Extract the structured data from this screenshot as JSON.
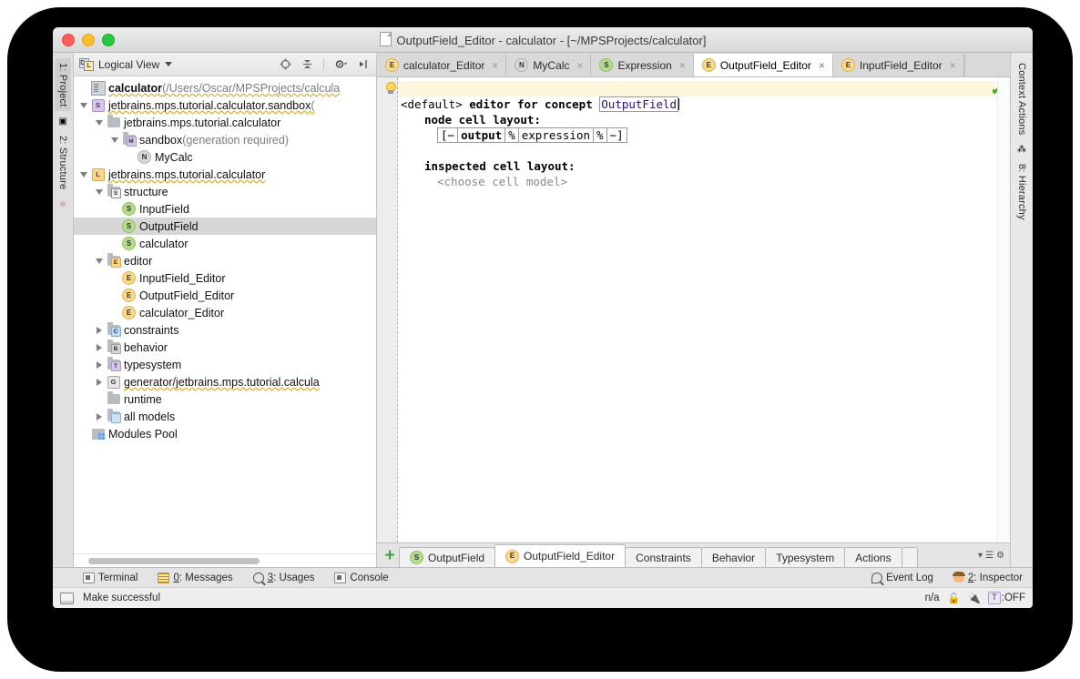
{
  "window": {
    "title": "OutputField_Editor - calculator - [~/MPSProjects/calculator]",
    "traffic": {
      "close": "close-button",
      "minimize": "minimize-button",
      "zoom": "zoom-button"
    }
  },
  "left_strip": {
    "tabs": [
      {
        "label": "1: Project",
        "active": true
      },
      {
        "label": "2: Structure",
        "active": false
      }
    ]
  },
  "right_strip": {
    "tabs": [
      {
        "label": "Context Actions"
      },
      {
        "label": "8: Hierarchy"
      }
    ]
  },
  "project_panel": {
    "view_label": "Logical View",
    "toolbar": {
      "locate": "locate-icon",
      "collapse": "collapse-all-icon",
      "settings": "gear-icon",
      "hide": "hide-panel-icon"
    },
    "tree": [
      {
        "indent": 0,
        "twist": "none",
        "icon": "project",
        "label": "calculator",
        "bold": true,
        "suffix": " (/Users/Oscar/MPSProjects/calcula",
        "squiggle": true
      },
      {
        "indent": 0,
        "twist": "down",
        "icon": "badge-s-purple",
        "label": "jetbrains.mps.tutorial.calculator.sandbox",
        "suffix": " (",
        "squiggle": true
      },
      {
        "indent": 1,
        "twist": "down",
        "icon": "folder",
        "label": "jetbrains.mps.tutorial.calculator"
      },
      {
        "indent": 2,
        "twist": "down",
        "icon": "folder-m",
        "label": "sandbox",
        "suffix": " (generation required)"
      },
      {
        "indent": 3,
        "twist": "none",
        "icon": "badge-n",
        "label": "MyCalc"
      },
      {
        "indent": 0,
        "twist": "down",
        "icon": "badge-l-orange",
        "label": "jetbrains.mps.tutorial.calculator",
        "squiggle": true
      },
      {
        "indent": 1,
        "twist": "down",
        "icon": "folder-s",
        "label": "structure"
      },
      {
        "indent": 2,
        "twist": "none",
        "icon": "badge-s",
        "label": "InputField"
      },
      {
        "indent": 2,
        "twist": "none",
        "icon": "badge-s",
        "label": "OutputField",
        "selected": true
      },
      {
        "indent": 2,
        "twist": "none",
        "icon": "badge-s",
        "label": "calculator"
      },
      {
        "indent": 1,
        "twist": "down",
        "icon": "folder-e",
        "label": "editor"
      },
      {
        "indent": 2,
        "twist": "none",
        "icon": "badge-e",
        "label": "InputField_Editor"
      },
      {
        "indent": 2,
        "twist": "none",
        "icon": "badge-e",
        "label": "OutputField_Editor"
      },
      {
        "indent": 2,
        "twist": "none",
        "icon": "badge-e",
        "label": "calculator_Editor"
      },
      {
        "indent": 1,
        "twist": "right",
        "icon": "folder-c",
        "label": "constraints"
      },
      {
        "indent": 1,
        "twist": "right",
        "icon": "folder-b",
        "label": "behavior"
      },
      {
        "indent": 1,
        "twist": "right",
        "icon": "folder-t",
        "label": "typesystem"
      },
      {
        "indent": 1,
        "twist": "right",
        "icon": "badge-g",
        "label": "generator/jetbrains.mps.tutorial.calcula",
        "squiggle": true
      },
      {
        "indent": 1,
        "twist": "none",
        "icon": "folder",
        "label": "runtime"
      },
      {
        "indent": 1,
        "twist": "right",
        "icon": "folder-mods",
        "label": "all models"
      },
      {
        "indent": 0,
        "twist": "none",
        "icon": "modules-pool",
        "label": "Modules Pool"
      }
    ]
  },
  "editor_tabs": [
    {
      "badge": "E",
      "label": "calculator_Editor",
      "active": false,
      "close": "×"
    },
    {
      "badge": "N",
      "label": "MyCalc",
      "active": false,
      "close": "×"
    },
    {
      "badge": "S",
      "label": "Expression",
      "active": false,
      "close": "×"
    },
    {
      "badge": "E",
      "label": "OutputField_Editor",
      "active": true,
      "close": "×"
    },
    {
      "badge": "E",
      "label": "InputField_Editor",
      "active": false,
      "close": "×"
    }
  ],
  "code": {
    "line1_prefix": "<default> ",
    "line1_mid": "editor for concept ",
    "line1_concept": "OutputField",
    "line2": "node cell layout:",
    "cell_parts": [
      "[−",
      "output",
      "%",
      "expression",
      "%",
      "−]"
    ],
    "line4": "inspected cell layout:",
    "line5": "<choose cell model>",
    "status_check": "✔"
  },
  "editor_bottom_tabs": {
    "add_label": "+",
    "tabs": [
      {
        "badge": "S",
        "label": "OutputField",
        "active": false
      },
      {
        "badge": "E",
        "label": "OutputField_Editor",
        "active": true
      },
      {
        "badge": "",
        "label": "Constraints",
        "active": false
      },
      {
        "badge": "",
        "label": "Behavior",
        "active": false
      },
      {
        "badge": "",
        "label": "Typesystem",
        "active": false
      },
      {
        "badge": "",
        "label": "Actions",
        "active": false
      }
    ]
  },
  "tool_windows": {
    "left": [
      {
        "icon": "terminal-icon",
        "label": "Terminal",
        "mnemonic": ""
      },
      {
        "icon": "messages-icon",
        "label": ": Messages",
        "mnemonic": "0"
      },
      {
        "icon": "usages-icon",
        "label": ": Usages",
        "mnemonic": "3"
      },
      {
        "icon": "console-icon",
        "label": "Console",
        "mnemonic": ""
      }
    ],
    "right": [
      {
        "icon": "event-log-icon",
        "label": "Event Log",
        "mnemonic": ""
      },
      {
        "icon": "inspector-icon",
        "label": ": Inspector",
        "mnemonic": "2"
      }
    ]
  },
  "status_bar": {
    "message": "Make successful",
    "right": {
      "na": "n/a",
      "lock": "🔓",
      "plug": "plug-icon",
      "toggle_key": "T",
      "toggle_state": ":OFF"
    }
  },
  "colors": {
    "accent_green": "#35a345",
    "highlight_row": "#fdf6dd",
    "selection": "#d6d6d6",
    "tab_active": "#ffffff"
  }
}
